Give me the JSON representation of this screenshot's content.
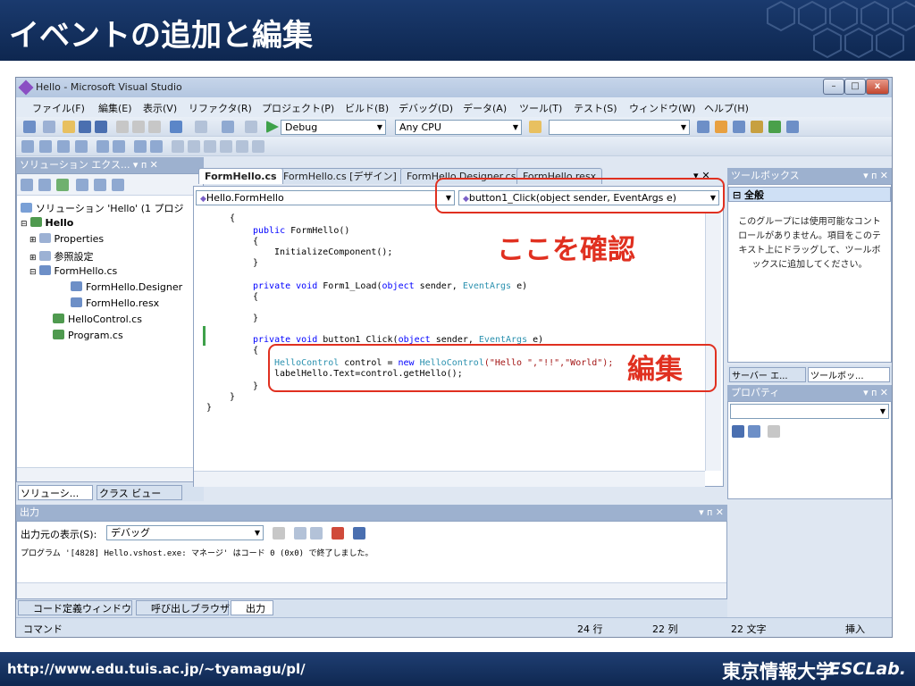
{
  "slide": {
    "title": "イベントの追加と編集",
    "url": "http://www.edu.tuis.ac.jp/~tyamagu/pl/",
    "university": "東京情報大学",
    "lab": "ESCLab."
  },
  "window": {
    "title": "Hello - Microsoft Visual Studio",
    "min": "–",
    "max": "□",
    "close": "x"
  },
  "menu": [
    "ファイル(F)",
    "編集(E)",
    "表示(V)",
    "リファクタ(R)",
    "プロジェクト(P)",
    "ビルド(B)",
    "デバッグ(D)",
    "データ(A)",
    "ツール(T)",
    "テスト(S)",
    "ウィンドウ(W)",
    "ヘルプ(H)"
  ],
  "toolbar": {
    "config": "Debug",
    "platform": "Any CPU"
  },
  "solution_explorer": {
    "header": "ソリューション エクス... ▾ ᴨ ✕",
    "items": [
      {
        "label": "ソリューション 'Hello' (1 プロジ",
        "indent": 0
      },
      {
        "label": "Hello",
        "indent": 1,
        "bold": true
      },
      {
        "label": "Properties",
        "indent": 2
      },
      {
        "label": "参照設定",
        "indent": 2
      },
      {
        "label": "FormHello.cs",
        "indent": 2
      },
      {
        "label": "FormHello.Designer",
        "indent": 3
      },
      {
        "label": "FormHello.resx",
        "indent": 3
      },
      {
        "label": "HelloControl.cs",
        "indent": 2
      },
      {
        "label": "Program.cs",
        "indent": 2
      }
    ],
    "tab1": "ソリューシ...",
    "tab2": "クラス ビュー"
  },
  "editor": {
    "tabs": [
      "FormHello.cs",
      "FormHello.cs [デザイン]",
      "FormHello.Designer.cs",
      "FormHello.resx"
    ],
    "class_combo": "Hello.FormHello",
    "method_combo": "button1_Click(object sender, EventArgs e)",
    "tab_close": "▾ ✕"
  },
  "toolbox": {
    "header": "ツールボックス",
    "pin": "▾ ᴨ ✕",
    "group": "全般",
    "message": "このグループには使用可能なコントロールがありません。項目をこのテキスト上にドラッグして、ツールボックスに追加してください。",
    "tab1": "サーバー エ...",
    "tab2": "ツールボッ..."
  },
  "properties": {
    "header": "プロパティ",
    "pin": "▾ ᴨ ✕"
  },
  "output": {
    "header": "出力",
    "pin": "▾ ᴨ ✕",
    "source_label": "出力元の表示(S):",
    "source": "デバッグ",
    "text": "プログラム '[4828] Hello.vshost.exe: マネージ' はコード 0 (0x0) で終了しました。",
    "tabs": [
      "コード定義ウィンドウ",
      "呼び出しブラウザ",
      "出力"
    ]
  },
  "status": {
    "command": "コマンド",
    "line": "24 行",
    "col": "22 列",
    "chars": "22 文字",
    "mode": "挿入"
  },
  "annotations": {
    "check": "ここを確認",
    "edit": "編集"
  },
  "code": {
    "l1": "{",
    "l2k": "public ",
    "l2": "FormHello()",
    "l3": "{",
    "l4": "InitializeComponent();",
    "l5": "}",
    "l6k": "private void ",
    "l6a": "Form1_Load(",
    "l6b": "object ",
    "l6c": "sender, ",
    "l6d": "EventArgs ",
    "l6e": "e)",
    "l7": "{",
    "l8": "}",
    "l9k": "private void ",
    "l9a": "button1_Click(",
    "l9b": "object ",
    "l9c": "sender, ",
    "l9d": "EventArgs ",
    "l9e": "e)",
    "l10": "{",
    "l11t": "HelloControl ",
    "l11a": "control = ",
    "l11n": "new ",
    "l11t2": "HelloControl",
    "l11s": "(\"Hello \",\"!!\",\"World\");",
    "l12": "labelHello.Text=control.getHello();",
    "l13": "}",
    "l14": "}",
    "l15": "}"
  }
}
